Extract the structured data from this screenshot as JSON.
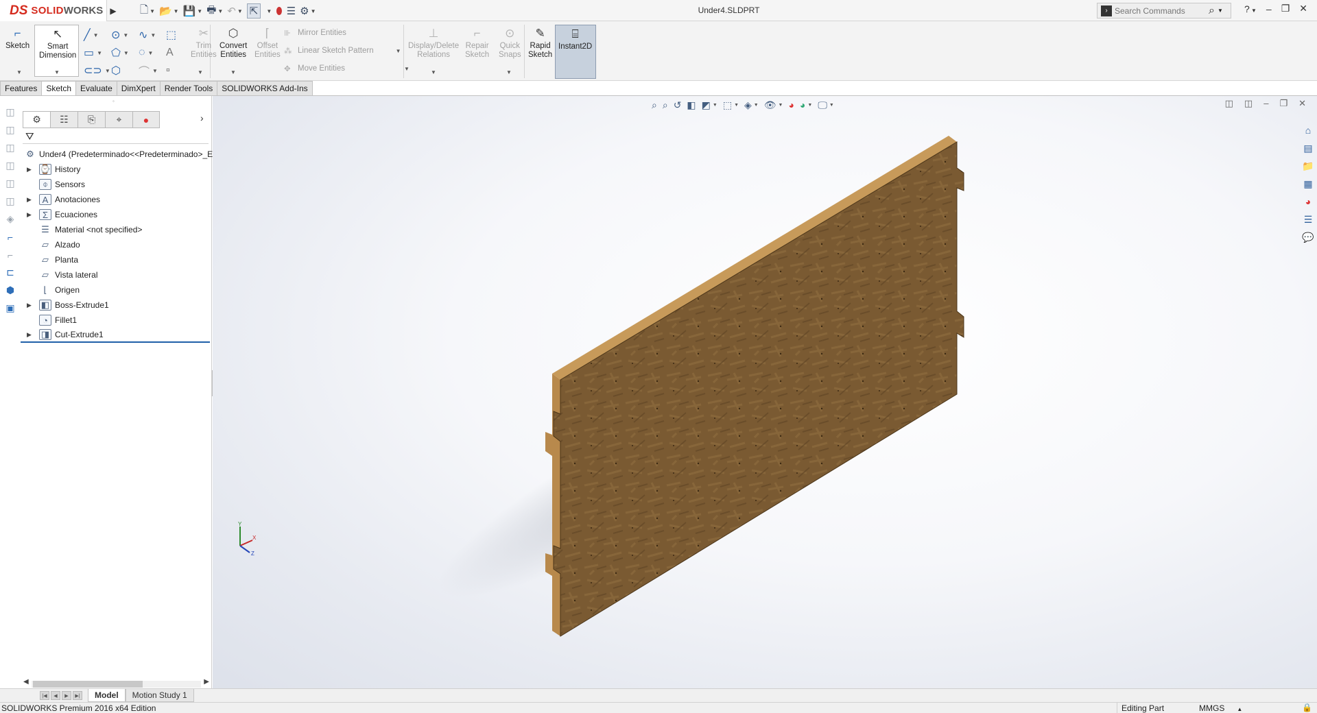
{
  "app": {
    "brand_prefix": "DS",
    "brand_name": "SOLID",
    "brand_name_2": "WORKS",
    "document_title": "Under4.SLDPRT",
    "brand_color": "#d52b1e"
  },
  "search": {
    "placeholder": "Search Commands"
  },
  "commandmanager": {
    "sketch": "Sketch",
    "smart_dimension_1": "Smart",
    "smart_dimension_2": "Dimension",
    "trim_1": "Trim",
    "trim_2": "Entities",
    "convert_1": "Convert",
    "convert_2": "Entities",
    "offset_1": "Offset",
    "offset_2": "Entities",
    "mirror": "Mirror Entities",
    "linear_pattern": "Linear Sketch Pattern",
    "move": "Move Entities",
    "display_delete_1": "Display/Delete",
    "display_delete_2": "Relations",
    "repair_1": "Repair",
    "repair_2": "Sketch",
    "quick_snaps_1": "Quick",
    "quick_snaps_2": "Snaps",
    "rapid_1": "Rapid",
    "rapid_2": "Sketch",
    "instant2d": "Instant2D"
  },
  "tabs": [
    "Features",
    "Sketch",
    "Evaluate",
    "DimXpert",
    "Render Tools",
    "SOLIDWORKS Add-Ins"
  ],
  "active_tab": "Sketch",
  "tree": {
    "root": "Under4  (Predeterminado<<Predeterminado>_E",
    "items": [
      {
        "label": "History",
        "icon": "history-folder-icon",
        "expandable": true
      },
      {
        "label": "Sensors",
        "icon": "sensors-folder-icon",
        "expandable": false
      },
      {
        "label": "Anotaciones",
        "icon": "annotations-icon",
        "expandable": true
      },
      {
        "label": "Ecuaciones",
        "icon": "equations-icon",
        "expandable": true
      },
      {
        "label": "Material <not specified>",
        "icon": "material-icon",
        "expandable": false
      },
      {
        "label": "Alzado",
        "icon": "plane-icon",
        "expandable": false
      },
      {
        "label": "Planta",
        "icon": "plane-icon",
        "expandable": false
      },
      {
        "label": "Vista lateral",
        "icon": "plane-icon",
        "expandable": false
      },
      {
        "label": "Origen",
        "icon": "origin-icon",
        "expandable": false
      },
      {
        "label": "Boss-Extrude1",
        "icon": "boss-extrude-icon",
        "expandable": true
      },
      {
        "label": "Fillet1",
        "icon": "fillet-icon",
        "expandable": false
      },
      {
        "label": "Cut-Extrude1",
        "icon": "cut-extrude-icon",
        "expandable": true
      }
    ]
  },
  "bottom_tabs": [
    "Model",
    "Motion Study 1"
  ],
  "status": {
    "edition": "SOLIDWORKS Premium 2016 x64 Edition",
    "mode": "Editing Part",
    "units": "MMGS"
  },
  "colors": {
    "accent": "#2e6eb8",
    "wood_face": "#7a5a32",
    "wood_edge": "#c79a5a"
  }
}
